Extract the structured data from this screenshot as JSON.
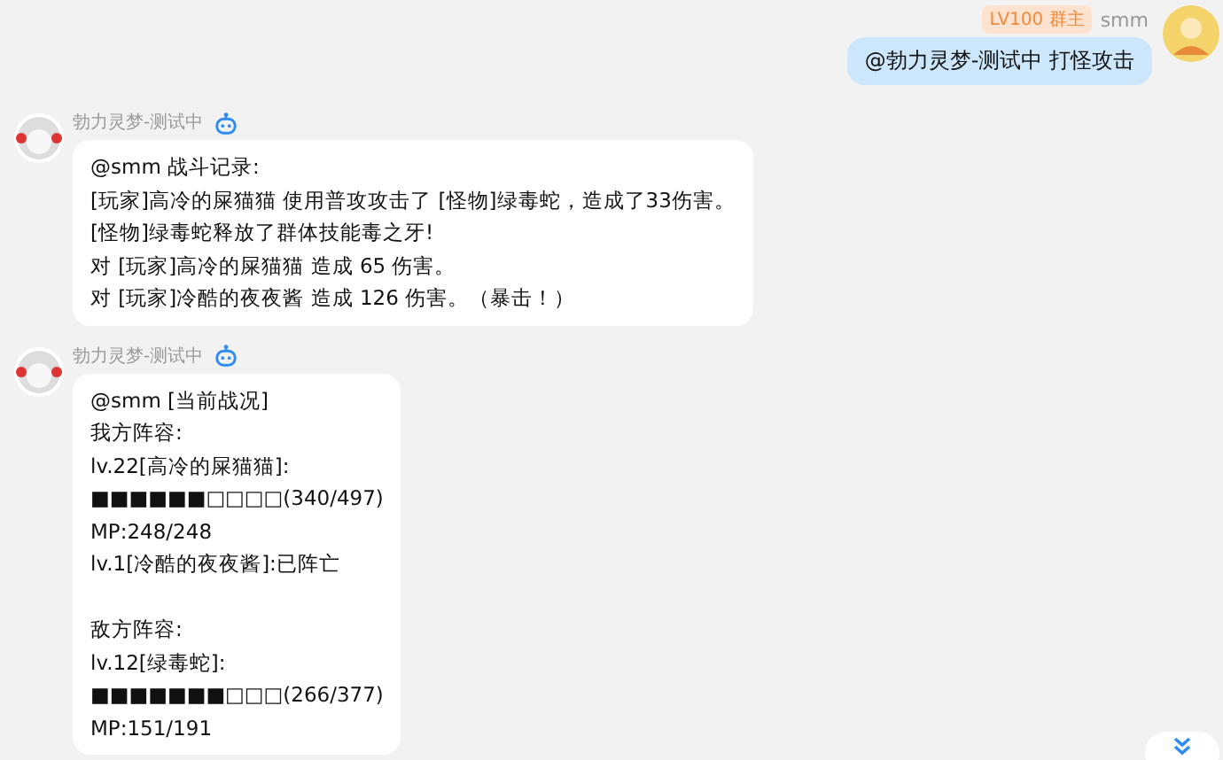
{
  "outgoing": {
    "badge": "LV100 群主",
    "sender": "smm",
    "text": "@勃力灵梦-测试中 打怪攻击"
  },
  "incoming": [
    {
      "sender": "勃力灵梦-测试中",
      "paragraphs": [
        [
          "@smm 战斗记录:",
          "[玩家]高冷的屎猫猫 使用普攻攻击了 [怪物]绿毒蛇，造成了33伤害。",
          "[怪物]绿毒蛇释放了群体技能毒之牙!",
          "对 [玩家]高冷的屎猫猫 造成 65 伤害。",
          "对 [玩家]冷酷的夜夜酱 造成 126 伤害。（暴击！）"
        ]
      ]
    },
    {
      "sender": "勃力灵梦-测试中",
      "paragraphs": [
        [
          "@smm [当前战况]",
          "我方阵容:",
          "lv.22[高冷的屎猫猫]:",
          "■■■■■■□□□□(340/497)",
          "MP:248/248",
          "lv.1[冷酷的夜夜酱]:已阵亡"
        ],
        [
          "敌方阵容:",
          "lv.12[绿毒蛇]:",
          "■■■■■■■□□□(266/377)",
          "MP:151/191"
        ]
      ]
    }
  ]
}
